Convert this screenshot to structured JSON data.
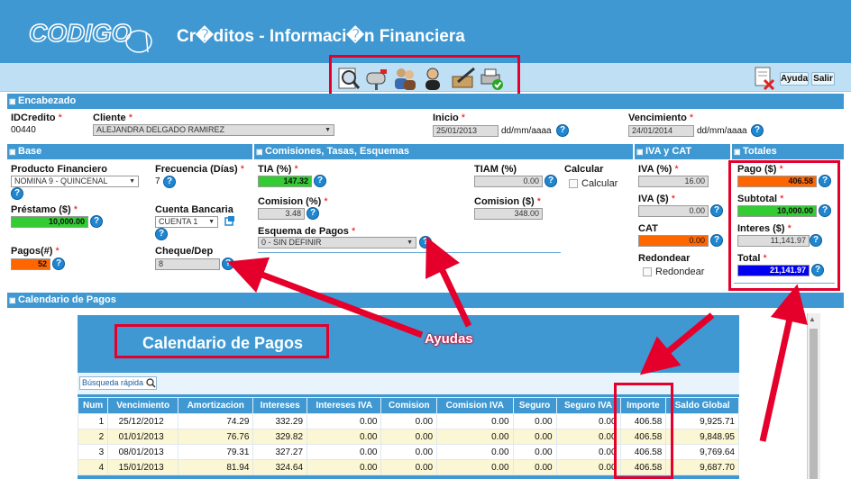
{
  "app": {
    "title": "Cr�ditos - Informaci�n Financiera",
    "logo_text": "CODIGO 01"
  },
  "toolbar": {
    "help_label": "Ayuda",
    "exit_label": "Salir",
    "icons": [
      "search-document-icon",
      "mailbox-icon",
      "users-icon",
      "user-icon",
      "sign-document-icon",
      "printer-check-icon"
    ]
  },
  "encabezado": {
    "title": "Encabezado",
    "id_label": "IDCredito",
    "id_value": "00440",
    "cliente_label": "Cliente",
    "cliente_value": "ALEJANDRA DELGADO RAMIREZ",
    "inicio_label": "Inicio",
    "inicio_value": "25/01/2013",
    "inicio_fmt": "dd/mm/aaaa",
    "venc_label": "Vencimiento",
    "venc_value": "24/01/2014",
    "venc_fmt": "dd/mm/aaaa"
  },
  "base": {
    "title": "Base",
    "producto_label": "Producto Financiero",
    "producto_value": "NOMINA 9 - QUINCENAL",
    "frecuencia_label": "Frecuencia (Días)",
    "frecuencia_value": "7",
    "prestamo_label": "Préstamo ($)",
    "prestamo_value": "10,000.00",
    "cuenta_label": "Cuenta Bancaria",
    "cuenta_value": "CUENTA 1",
    "pagos_label": "Pagos(#)",
    "pagos_value": "52",
    "cheque_label": "Cheque/Dep",
    "cheque_value": "8"
  },
  "comisiones": {
    "title": "Comisiones, Tasas, Esquemas",
    "tia_label": "TIA (%)",
    "tia_value": "147.32",
    "tiam_label": "TIAM (%)",
    "tiam_value": "0.00",
    "calcular_label": "Calcular",
    "calcular_chk_label": "Calcular",
    "comision_pct_label": "Comision (%)",
    "comision_pct_value": "3.48",
    "comision_amt_label": "Comision ($)",
    "comision_amt_value": "348.00",
    "esquema_label": "Esquema de Pagos",
    "esquema_value": "0 - SIN DEFINIR"
  },
  "iva": {
    "title": "IVA y CAT",
    "iva_pct_label": "IVA (%)",
    "iva_pct_value": "16.00",
    "iva_amt_label": "IVA ($)",
    "iva_amt_value": "0.00",
    "cat_label": "CAT",
    "cat_value": "0.00",
    "redondear_label": "Redondear",
    "redondear_chk_label": "Redondear"
  },
  "totales": {
    "title": "Totales",
    "pago_label": "Pago ($)",
    "pago_value": "406.58",
    "subtotal_label": "Subtotal",
    "subtotal_value": "10,000.00",
    "interes_label": "Interes ($)",
    "interes_value": "11,141.97",
    "total_label": "Total",
    "total_value": "21,141.97"
  },
  "calendario": {
    "section_title": "Calendario de Pagos",
    "title": "Calendario de Pagos",
    "search_placeholder": "Búsqueda rápida",
    "columns": [
      "Num",
      "Vencimiento",
      "Amortizacion",
      "Intereses",
      "Intereses IVA",
      "Comision",
      "Comision IVA",
      "Seguro",
      "Seguro IVA",
      "Importe",
      "Saldo Global"
    ],
    "rows": [
      [
        "1",
        "25/12/2012",
        "74.29",
        "332.29",
        "0.00",
        "0.00",
        "0.00",
        "0.00",
        "0.00",
        "406.58",
        "9,925.71"
      ],
      [
        "2",
        "01/01/2013",
        "76.76",
        "329.82",
        "0.00",
        "0.00",
        "0.00",
        "0.00",
        "0.00",
        "406.58",
        "9,848.95"
      ],
      [
        "3",
        "08/01/2013",
        "79.31",
        "327.27",
        "0.00",
        "0.00",
        "0.00",
        "0.00",
        "0.00",
        "406.58",
        "9,769.64"
      ],
      [
        "4",
        "15/01/2013",
        "81.94",
        "324.64",
        "0.00",
        "0.00",
        "0.00",
        "0.00",
        "0.00",
        "406.58",
        "9,687.70"
      ]
    ]
  },
  "annotation": {
    "ayudas_label": "Ayudas",
    "accent_color": "#e4002b"
  },
  "colors": {
    "header_blue": "#3f98d2",
    "green": "#33cc33",
    "orange": "#ff6600",
    "total_blue": "#0000ee"
  }
}
